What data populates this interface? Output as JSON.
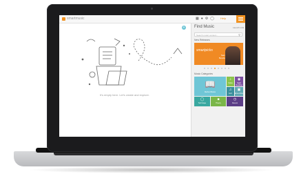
{
  "app": {
    "brand": "smartmusic"
  },
  "topbar": {
    "icons": [
      "grid-icon",
      "bell-icon",
      "settings-icon",
      "user-icon"
    ],
    "help_label": "Help",
    "accent": "#f29322"
  },
  "main": {
    "empty_text": "It's empty here. Let's create and explore."
  },
  "sidebar": {
    "title": "Find Music",
    "link": "Launch Link",
    "search_placeholder": "Search music content...",
    "section_new": "New Releases",
    "banner_title": "smartpicks",
    "banner_name": "Sam Bevide",
    "section_categories": "Music Categories",
    "tiles": [
      {
        "label": "Method Books",
        "icon": "book-icon",
        "color": "#6fc6d6"
      },
      {
        "label": "Solos",
        "icon": "music-note-icon",
        "color": "#8bc34a"
      },
      {
        "label": "Sight Reading",
        "icon": "eye-icon",
        "color": "#7b4fa0"
      },
      {
        "label": "Jazz",
        "icon": "sax-icon",
        "color": "#3a8f9c"
      },
      {
        "label": "Ensembles",
        "icon": "group-icon",
        "color": "#5fa8b3"
      },
      {
        "label": "Technique",
        "icon": "metronome-icon",
        "color": "#3aa8a0"
      },
      {
        "label": "Theory",
        "icon": "theory-icon",
        "color": "#7ab648"
      },
      {
        "label": "Recent",
        "icon": "clock-icon",
        "color": "#5b3e86"
      }
    ]
  }
}
